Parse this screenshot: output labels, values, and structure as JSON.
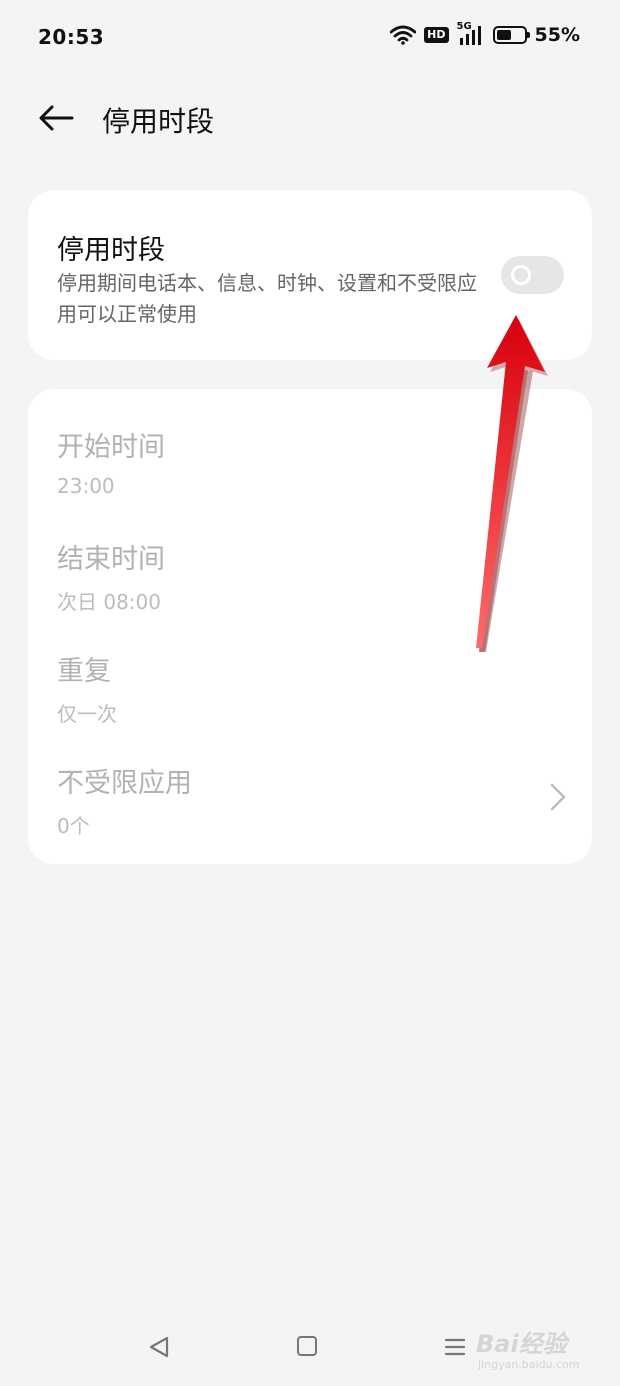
{
  "status_bar": {
    "time": "20:53",
    "hd_label": "HD",
    "network_label": "5G",
    "battery_percent": "55%",
    "battery_level": 0.55
  },
  "header": {
    "title": "停用时段",
    "back_icon": "arrow-left-icon"
  },
  "toggle_card": {
    "title": "停用时段",
    "description": "停用期间电话本、信息、时钟、设置和不受限应用可以正常使用",
    "enabled": false
  },
  "settings": [
    {
      "label": "开始时间",
      "value": "23:00"
    },
    {
      "label": "结束时间",
      "value": "次日 08:00"
    },
    {
      "label": "重复",
      "value": "仅一次"
    },
    {
      "label": "不受限应用",
      "value": "0个"
    }
  ],
  "watermark": {
    "brand": "Bai经验",
    "url": "jingyan.baidu.com"
  },
  "colors": {
    "background": "#f4f4f4",
    "card": "#ffffff",
    "disabled_text": "#b2b2b2",
    "toggle_off": "#e6e6e6",
    "annotation_arrow": "#e8141c"
  }
}
